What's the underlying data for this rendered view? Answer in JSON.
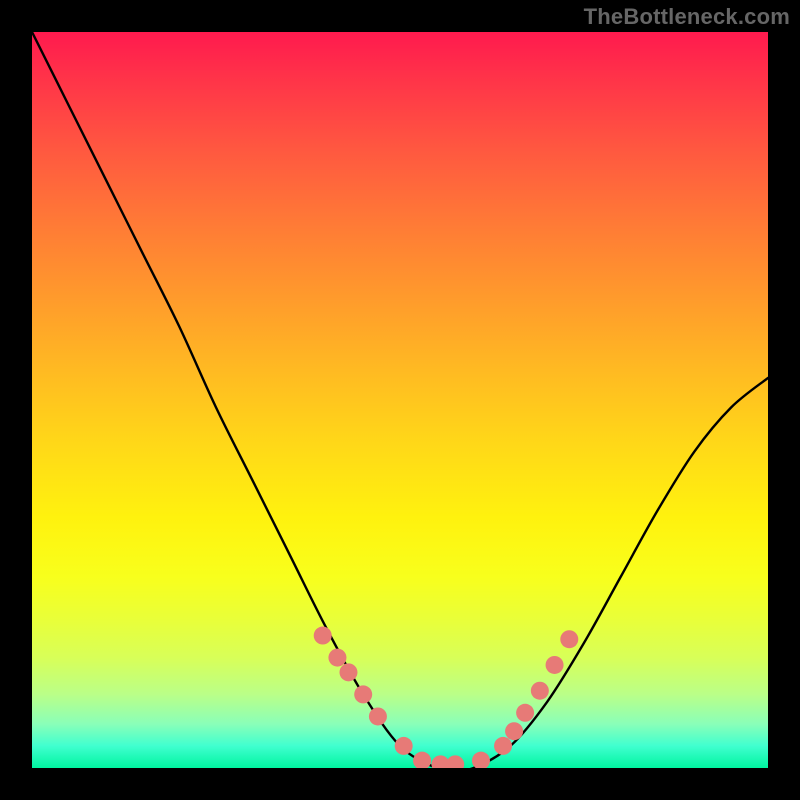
{
  "watermark": "TheBottleneck.com",
  "colors": {
    "bg": "#000000",
    "curve": "#000000",
    "dot": "#e77a77",
    "watermark": "#666666"
  },
  "chart_data": {
    "type": "line",
    "title": "",
    "xlabel": "",
    "ylabel": "",
    "xlim": [
      0,
      1
    ],
    "ylim": [
      0,
      1
    ],
    "series": [
      {
        "name": "curve",
        "x": [
          0.0,
          0.05,
          0.1,
          0.15,
          0.2,
          0.25,
          0.3,
          0.35,
          0.4,
          0.45,
          0.5,
          0.55,
          0.575,
          0.6,
          0.65,
          0.7,
          0.75,
          0.8,
          0.85,
          0.9,
          0.95,
          1.0
        ],
        "y": [
          1.0,
          0.9,
          0.8,
          0.7,
          0.6,
          0.49,
          0.39,
          0.29,
          0.19,
          0.1,
          0.03,
          0.0,
          0.0,
          0.0,
          0.03,
          0.09,
          0.17,
          0.26,
          0.35,
          0.43,
          0.49,
          0.53
        ]
      }
    ],
    "dots": {
      "name": "highlight-segment",
      "x": [
        0.395,
        0.415,
        0.43,
        0.45,
        0.47,
        0.505,
        0.53,
        0.555,
        0.575,
        0.61,
        0.64,
        0.655,
        0.67,
        0.69,
        0.71,
        0.73
      ],
      "y": [
        0.18,
        0.15,
        0.13,
        0.1,
        0.07,
        0.03,
        0.01,
        0.005,
        0.005,
        0.01,
        0.03,
        0.05,
        0.075,
        0.105,
        0.14,
        0.175
      ]
    }
  }
}
